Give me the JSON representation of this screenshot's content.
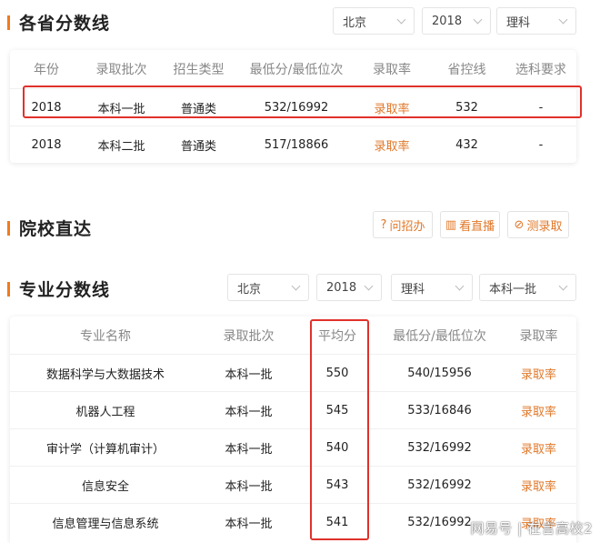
{
  "section1": {
    "title": "各省分数线",
    "filters": {
      "province": "北京",
      "year": "2018",
      "subject": "理科"
    },
    "headers": [
      "年份",
      "录取批次",
      "招生类型",
      "最低分/最低位次",
      "录取率",
      "省控线",
      "选科要求"
    ],
    "rows": [
      {
        "year": "2018",
        "batch": "本科一批",
        "type": "普通类",
        "min": "532/16992",
        "rate": "录取率",
        "control": "532",
        "req": "-"
      },
      {
        "year": "2018",
        "batch": "本科二批",
        "type": "普通类",
        "min": "517/18866",
        "rate": "录取率",
        "control": "432",
        "req": "-"
      }
    ]
  },
  "section2": {
    "title": "院校直达",
    "buttons": [
      {
        "icon": "?",
        "label": "问招办"
      },
      {
        "icon": "▥",
        "label": "看直播"
      },
      {
        "icon": "⊘",
        "label": "测录取"
      }
    ]
  },
  "section3": {
    "title": "专业分数线",
    "filters": {
      "province": "北京",
      "year": "2018",
      "subject": "理科",
      "batch": "本科一批"
    },
    "headers": [
      "专业名称",
      "录取批次",
      "平均分",
      "最低分/最低位次",
      "录取率"
    ],
    "rows": [
      {
        "name": "数据科学与大数据技术",
        "batch": "本科一批",
        "avg": "550",
        "min": "540/15956",
        "rate": "录取率"
      },
      {
        "name": "机器人工程",
        "batch": "本科一批",
        "avg": "545",
        "min": "533/16846",
        "rate": "录取率"
      },
      {
        "name": "审计学（计算机审计）",
        "batch": "本科一批",
        "avg": "540",
        "min": "532/16992",
        "rate": "录取率"
      },
      {
        "name": "信息安全",
        "batch": "本科一批",
        "avg": "543",
        "min": "532/16992",
        "rate": "录取率"
      },
      {
        "name": "信息管理与信息系统",
        "batch": "本科一批",
        "avg": "541",
        "min": "532/16992",
        "rate": "录取率"
      }
    ]
  },
  "watermark": "网易号 | 在言高校2",
  "colors": {
    "accent": "#f07a1f",
    "highlight": "#e0312b"
  }
}
